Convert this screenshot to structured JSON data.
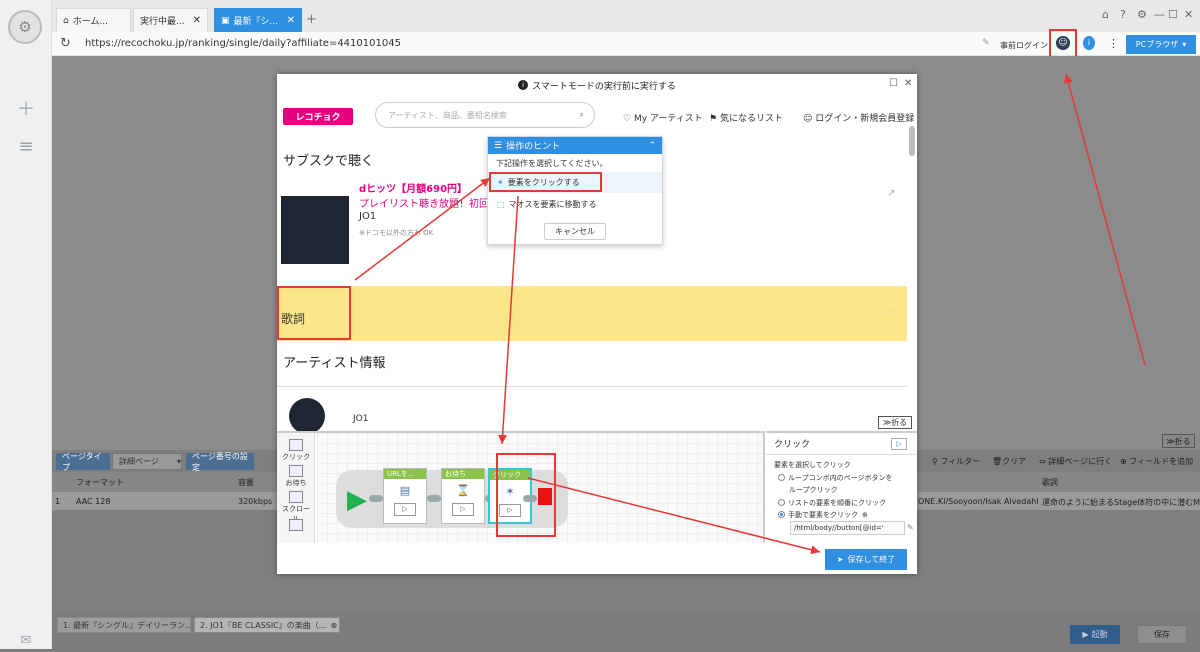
{
  "browser": {
    "tabs": [
      "ホーム...",
      "実行中最...",
      "最新『シ..."
    ],
    "add_tab_icon": "+",
    "url": "https://recochoku.jp/ranking/single/daily?affiliate=4410101045",
    "login_label": "事前ログイン",
    "pc_browser_label": "PCブラウザ"
  },
  "dialog": {
    "title": "スマートモードの実行前に実行する",
    "page": {
      "logo": "レコチョク",
      "search_placeholder": "アーティスト、商品、番組名検索",
      "nav": [
        "My アーティスト",
        "気になるリスト",
        "ログイン・新規会員登録"
      ],
      "subscribe_heading": "サブスクで聴く",
      "dhits_title": "dヒッツ【月額690円】",
      "dhits_sub": "プレイリスト聴き放題！初回31",
      "artist": "JO1",
      "note": "※ドコモ以外の方も OK",
      "lyrics_heading": "歌詞",
      "artist_info_heading": "アーティスト情報",
      "artist_name": "JO1",
      "fold_label": "折る"
    },
    "hint": {
      "title": "操作のヒント",
      "instruction": "下記操作を選択してください。",
      "options": [
        "要素をクリックする",
        "マオスを要素に移動する"
      ],
      "cancel_label": "キャンセル"
    },
    "workflow": {
      "tools": [
        "クリック",
        "お待ち",
        "スクロール"
      ],
      "nodes": [
        "URLを...",
        "お待ち",
        "クリック"
      ]
    },
    "properties": {
      "title": "クリック",
      "label": "要素を選択してクリック",
      "options": [
        "ループコンボ内のページボタンを",
        "ループクリック",
        "リストの要素を順番にクリック",
        "手動で要素をクリック"
      ],
      "xpath": "/html/body//button[@id='",
      "save_finish_label": "保存して終了"
    }
  },
  "lower": {
    "page_type_label": "ページタイプ",
    "page_type_value": "詳細ページ",
    "page_number_setting": "ページ番号の設定",
    "toolbar": [
      "フィルター",
      "クリア",
      "詳細ページに行く",
      "フィールドを追加"
    ],
    "fold_label": "折る",
    "columns": [
      "フォーマット",
      "容量",
      "歌詞"
    ],
    "row": {
      "index": "1",
      "format": "AAC 128",
      "size": "320kbps",
      "credits": "ONE.KI/Sooyoon/Isak Alvedahl",
      "lyrics": "運命のように始まるStage体符の中に潜むM..."
    }
  },
  "bottom_tabs": [
    "1. 最新『シングル』デイリーラン...",
    "2. JO1『BE CLASSIC』の楽曲（..."
  ],
  "bottom_buttons": {
    "run": "起動",
    "save": "保存"
  },
  "colors": {
    "accent": "#2f8fe0",
    "brand": "#e6007e",
    "highlight": "#e53935"
  }
}
